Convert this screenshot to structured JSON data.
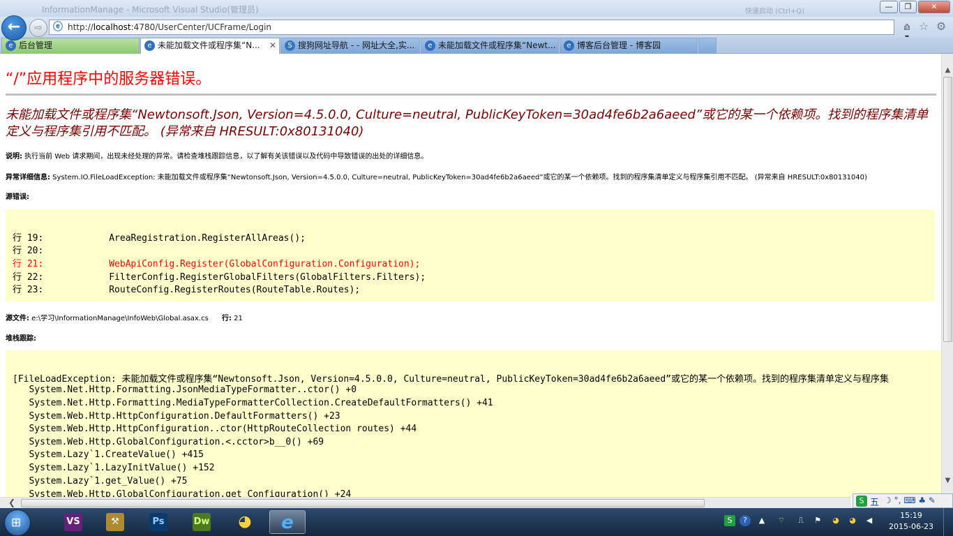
{
  "window": {
    "title": "InformationManage - Microsoft Visual Studio(管理员)",
    "title_right": "快速启动 (Ctrl+Q)",
    "minimize": "—",
    "maximize": "❐",
    "close": "✕"
  },
  "nav": {
    "back": "←",
    "forward": "⇨",
    "url_prefix": "http://",
    "url_host": "localhost",
    "url_rest": ":4780/UserCenter/UCFrame/Login",
    "addr_tools": "⌕ ▾ ↻"
  },
  "icons": [
    "back-icon",
    "forward-icon",
    "ie-icon",
    "search-icon",
    "refresh-icon",
    "home-icon",
    "favorites-icon",
    "gear-icon",
    "close-icon"
  ],
  "tabs": [
    {
      "label": "后台管理",
      "style": "green"
    },
    {
      "label": "未能加载文件或程序集“N...",
      "style": "active",
      "close": "✕"
    },
    {
      "label": "搜狗网址导航 - - 网址大全,实...",
      "style": "normal"
    },
    {
      "label": "未能加载文件或程序集“Newt...",
      "style": "normal"
    },
    {
      "label": "博客后台管理 - 博客园",
      "style": "normal"
    }
  ],
  "page": {
    "h1": "“/”应用程序中的服务器错误。",
    "h2": "未能加载文件或程序集“Newtonsoft.Json, Version=4.5.0.0, Culture=neutral, PublicKeyToken=30ad4fe6b2a6aeed”或它的某一个依赖项。找到的程序集清单定义与程序集引用不匹配。 (异常来自 HRESULT:0x80131040)",
    "desc_label": "说明:",
    "desc_text": " 执行当前 Web 请求期间，出现未经处理的异常。请检查堆栈跟踪信息，以了解有关该错误以及代码中导致错误的出处的详细信息。",
    "exc_label": "异常详细信息:",
    "exc_text": " System.IO.FileLoadException: 未能加载文件或程序集“Newtonsoft.Json, Version=4.5.0.0, Culture=neutral, PublicKeyToken=30ad4fe6b2a6aeed”或它的某一个依赖项。找到的程序集清单定义与程序集引用不匹配。 (异常来自 HRESULT:0x80131040)",
    "source_error_label": "源错误:",
    "source_lines": [
      "行 19:            AreaRegistration.RegisterAllAreas();",
      "行 20:",
      "行 21:            WebApiConfig.Register(GlobalConfiguration.Configuration);",
      "行 22:            FilterConfig.RegisterGlobalFilters(GlobalFilters.Filters);",
      "行 23:            RouteConfig.RegisterRoutes(RouteTable.Routes);"
    ],
    "error_line_index": 2,
    "source_file_label": "源文件:",
    "source_file": " e:\\学习\\InformationManage\\InfoWeb\\Global.asax.cs",
    "line_label": "行:",
    "line_number": " 21",
    "stack_label": "堆栈跟踪:",
    "stack_lines": [
      "[FileLoadException: 未能加载文件或程序集“Newtonsoft.Json, Version=4.5.0.0, Culture=neutral, PublicKeyToken=30ad4fe6b2a6aeed”或它的某一个依赖项。找到的程序集清单定义与程序集",
      "   System.Net.Http.Formatting.JsonMediaTypeFormatter..ctor() +0",
      "   System.Net.Http.Formatting.MediaTypeFormatterCollection.CreateDefaultFormatters() +41",
      "   System.Web.Http.HttpConfiguration.DefaultFormatters() +23",
      "   System.Web.Http.HttpConfiguration..ctor(HttpRouteCollection routes) +44",
      "   System.Web.Http.GlobalConfiguration.<.cctor>b__0() +69",
      "   System.Lazy`1.CreateValue() +415",
      "   System.Lazy`1.LazyInitValue() +152",
      "   System.Lazy`1.get_Value() +75",
      "   System.Web.Http.GlobalConfiguration.get_Configuration() +24"
    ]
  },
  "ime": {
    "logo": "S",
    "mode": "五",
    "items": "☽ °, ⌨ ♣ ✎"
  },
  "taskbar": {
    "apps": [
      {
        "name": "visual-studio",
        "label": "VS",
        "color": "#68217a"
      },
      {
        "name": "tools",
        "label": "⚒",
        "color": "#b08a2e"
      },
      {
        "name": "photoshop",
        "label": "Ps",
        "color": "#0b3a6e"
      },
      {
        "name": "dreamweaver",
        "label": "Dw",
        "color": "#4c7a1c"
      },
      {
        "name": "qq",
        "label": "◕",
        "color": "#222"
      },
      {
        "name": "internet-explorer",
        "label": "e",
        "color": "#1f6fd0"
      }
    ],
    "time": "15:19",
    "date": "2015-06-23"
  },
  "colors": {
    "error_red": "#ff0000",
    "heading_maroon": "#800000",
    "code_bg": "#ffffcc"
  }
}
